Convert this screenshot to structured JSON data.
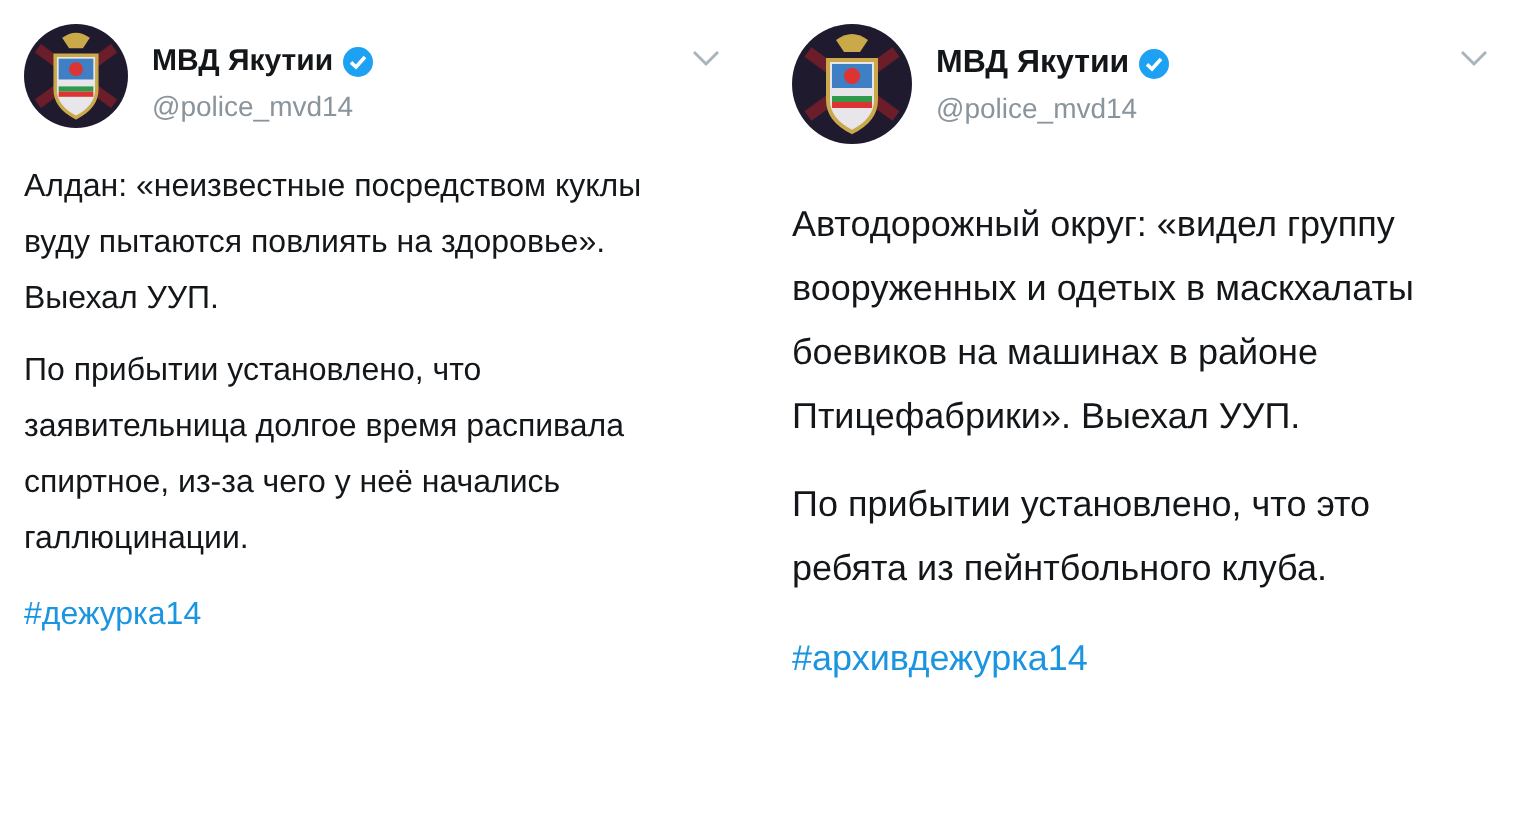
{
  "tweets": [
    {
      "author": {
        "name": "МВД Якутии",
        "verified": true,
        "handle": "@police_mvd14"
      },
      "paragraphs": [
        "Алдан: «неизвестные посредством куклы вуду пытаются повлиять на здоровье». Выехал УУП.",
        "По прибытии установлено, что заявительница долгое время распивала спиртное, из-за чего у неё начались галлюцинации."
      ],
      "hashtag": "#дежурка14"
    },
    {
      "author": {
        "name": "МВД Якутии",
        "verified": true,
        "handle": "@police_mvd14"
      },
      "paragraphs": [
        "Автодорожный округ: «видел группу вооруженных и одетых в маскхалаты боевиков на машинах в районе Птицефабрики». Выехал УУП.",
        "По прибытии установлено, что это ребята из пейнтбольного клуба."
      ],
      "hashtag": "#архивдежурка14"
    }
  ]
}
